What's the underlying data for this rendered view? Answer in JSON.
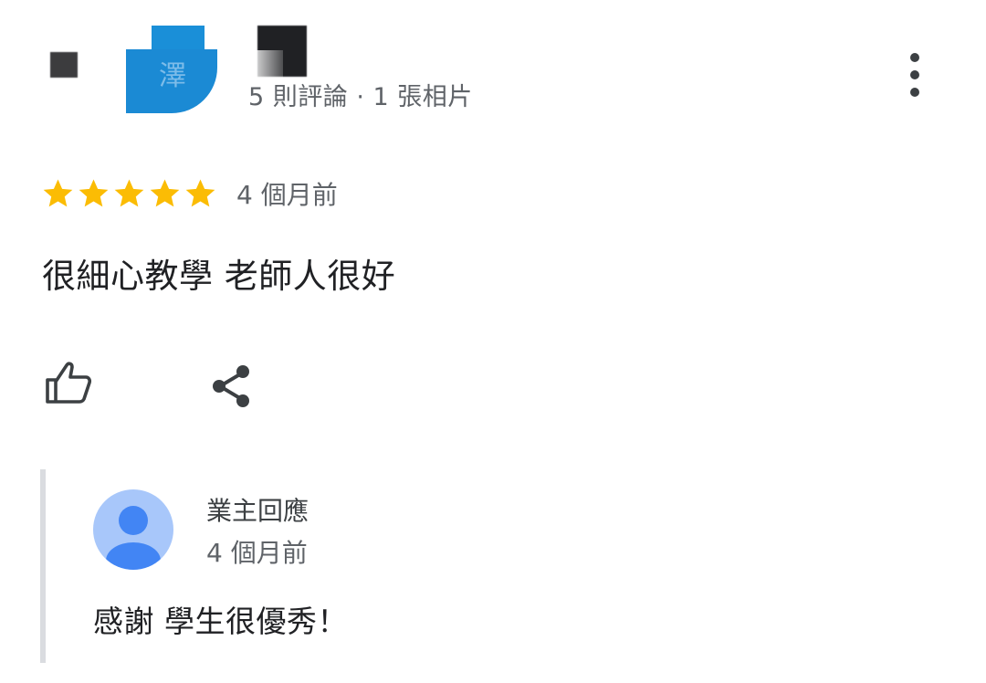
{
  "reviewer": {
    "avatar_glyph": "澤",
    "meta": "5 則評論 · 1 張相片"
  },
  "review": {
    "rating": 5,
    "max_rating": 5,
    "time": "4 個月前",
    "text": "很細心教學 老師人很好"
  },
  "actions": {
    "like_icon": "thumb-up-icon",
    "share_icon": "share-icon",
    "more_icon": "more-vert-icon"
  },
  "owner_reply": {
    "title": "業主回應",
    "time": "4 個月前",
    "text": "感謝 學生很優秀！"
  },
  "colors": {
    "star": "#FBBC04",
    "reply_border": "#dadce0",
    "avatar_bg": "#a8c7fa",
    "avatar_fg": "#4285f4",
    "reviewer_avatar": "#1b8ad4"
  }
}
